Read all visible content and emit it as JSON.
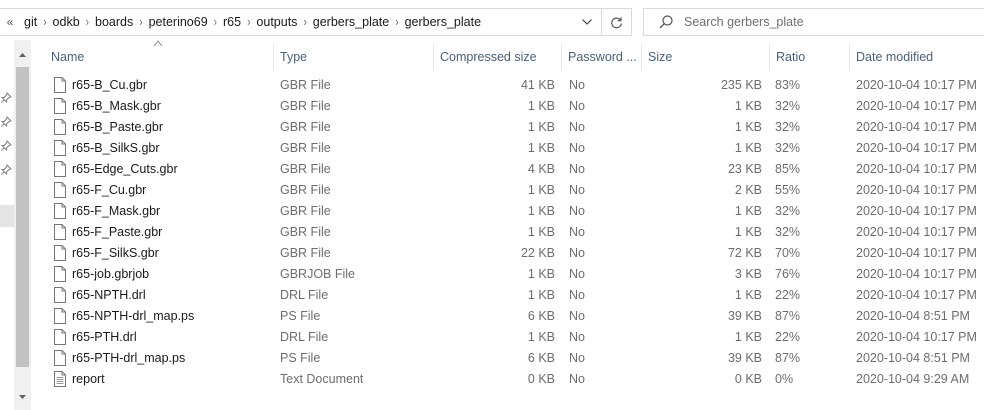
{
  "address_bar": {
    "overflow": "«",
    "crumbs": [
      "git",
      "odkb",
      "boards",
      "peterino69",
      "r65",
      "outputs",
      "gerbers_plate",
      "gerbers_plate"
    ]
  },
  "search": {
    "placeholder": "Search gerbers_plate"
  },
  "columns": {
    "name": "Name",
    "type": "Type",
    "compressed_size": "Compressed size",
    "password": "Password ...",
    "size": "Size",
    "ratio": "Ratio",
    "date_modified": "Date modified"
  },
  "files": [
    {
      "name": "r65-B_Cu.gbr",
      "type": "GBR File",
      "compressed_size": "41 KB",
      "password": "No",
      "size": "235 KB",
      "ratio": "83%",
      "date": "2020-10-04 10:17 PM"
    },
    {
      "name": "r65-B_Mask.gbr",
      "type": "GBR File",
      "compressed_size": "1 KB",
      "password": "No",
      "size": "1 KB",
      "ratio": "32%",
      "date": "2020-10-04 10:17 PM"
    },
    {
      "name": "r65-B_Paste.gbr",
      "type": "GBR File",
      "compressed_size": "1 KB",
      "password": "No",
      "size": "1 KB",
      "ratio": "32%",
      "date": "2020-10-04 10:17 PM"
    },
    {
      "name": "r65-B_SilkS.gbr",
      "type": "GBR File",
      "compressed_size": "1 KB",
      "password": "No",
      "size": "1 KB",
      "ratio": "32%",
      "date": "2020-10-04 10:17 PM"
    },
    {
      "name": "r65-Edge_Cuts.gbr",
      "type": "GBR File",
      "compressed_size": "4 KB",
      "password": "No",
      "size": "23 KB",
      "ratio": "85%",
      "date": "2020-10-04 10:17 PM"
    },
    {
      "name": "r65-F_Cu.gbr",
      "type": "GBR File",
      "compressed_size": "1 KB",
      "password": "No",
      "size": "2 KB",
      "ratio": "55%",
      "date": "2020-10-04 10:17 PM"
    },
    {
      "name": "r65-F_Mask.gbr",
      "type": "GBR File",
      "compressed_size": "1 KB",
      "password": "No",
      "size": "1 KB",
      "ratio": "32%",
      "date": "2020-10-04 10:17 PM"
    },
    {
      "name": "r65-F_Paste.gbr",
      "type": "GBR File",
      "compressed_size": "1 KB",
      "password": "No",
      "size": "1 KB",
      "ratio": "32%",
      "date": "2020-10-04 10:17 PM"
    },
    {
      "name": "r65-F_SilkS.gbr",
      "type": "GBR File",
      "compressed_size": "22 KB",
      "password": "No",
      "size": "72 KB",
      "ratio": "70%",
      "date": "2020-10-04 10:17 PM"
    },
    {
      "name": "r65-job.gbrjob",
      "type": "GBRJOB File",
      "compressed_size": "1 KB",
      "password": "No",
      "size": "3 KB",
      "ratio": "76%",
      "date": "2020-10-04 10:17 PM"
    },
    {
      "name": "r65-NPTH.drl",
      "type": "DRL File",
      "compressed_size": "1 KB",
      "password": "No",
      "size": "1 KB",
      "ratio": "22%",
      "date": "2020-10-04 10:17 PM"
    },
    {
      "name": "r65-NPTH-drl_map.ps",
      "type": "PS File",
      "compressed_size": "6 KB",
      "password": "No",
      "size": "39 KB",
      "ratio": "87%",
      "date": "2020-10-04 8:51 PM"
    },
    {
      "name": "r65-PTH.drl",
      "type": "DRL File",
      "compressed_size": "1 KB",
      "password": "No",
      "size": "1 KB",
      "ratio": "22%",
      "date": "2020-10-04 10:17 PM"
    },
    {
      "name": "r65-PTH-drl_map.ps",
      "type": "PS File",
      "compressed_size": "6 KB",
      "password": "No",
      "size": "39 KB",
      "ratio": "87%",
      "date": "2020-10-04 8:51 PM"
    },
    {
      "name": "report",
      "type": "Text Document",
      "compressed_size": "0 KB",
      "password": "No",
      "size": "0 KB",
      "ratio": "0%",
      "date": "2020-10-04 9:29 AM",
      "icon": "text-document-icon"
    }
  ]
}
